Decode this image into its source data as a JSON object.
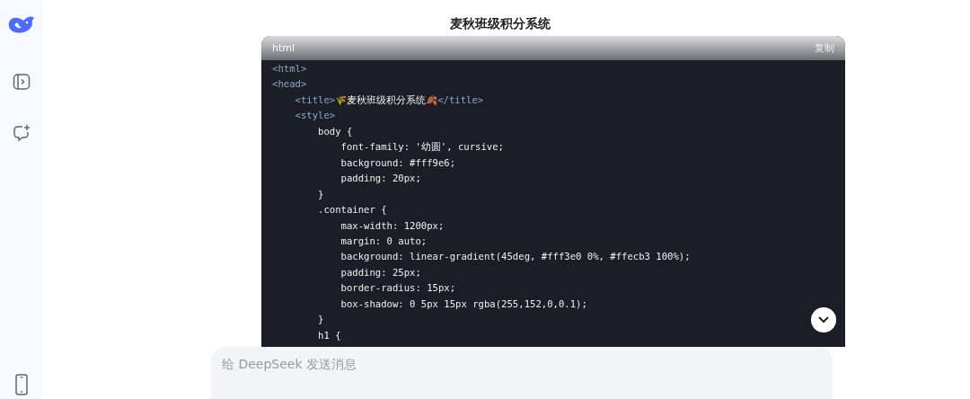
{
  "page_title": "麦秋班级积分系统",
  "code_block": {
    "language": "html",
    "copy_label": "复制",
    "lines": [
      [
        {
          "kind": "tag",
          "text": "<html>"
        }
      ],
      [
        {
          "kind": "tag",
          "text": "<head>"
        }
      ],
      [
        {
          "kind": "tag",
          "text": "    <title>"
        },
        {
          "kind": "text",
          "text": "🌾麦秋班级积分系统🍂"
        },
        {
          "kind": "tag",
          "text": "</title>"
        }
      ],
      [
        {
          "kind": "tag",
          "text": "    <style>"
        }
      ],
      [
        {
          "kind": "text",
          "text": "        body {"
        }
      ],
      [
        {
          "kind": "text",
          "text": "            font-family: '幼圆', cursive;"
        }
      ],
      [
        {
          "kind": "text",
          "text": "            background: #fff9e6;"
        }
      ],
      [
        {
          "kind": "text",
          "text": "            padding: 20px;"
        }
      ],
      [
        {
          "kind": "text",
          "text": "        }"
        }
      ],
      [
        {
          "kind": "text",
          "text": "        .container {"
        }
      ],
      [
        {
          "kind": "text",
          "text": "            max-width: 1200px;"
        }
      ],
      [
        {
          "kind": "text",
          "text": "            margin: 0 auto;"
        }
      ],
      [
        {
          "kind": "text",
          "text": "            background: linear-gradient(45deg, #fff3e0 0%, #ffecb3 100%);"
        }
      ],
      [
        {
          "kind": "text",
          "text": "            padding: 25px;"
        }
      ],
      [
        {
          "kind": "text",
          "text": "            border-radius: 15px;"
        }
      ],
      [
        {
          "kind": "text",
          "text": "            box-shadow: 0 5px 15px rgba(255,152,0,0.1);"
        }
      ],
      [
        {
          "kind": "text",
          "text": "        }"
        }
      ],
      [
        {
          "kind": "text",
          "text": "        h1 {"
        }
      ]
    ]
  },
  "composer": {
    "placeholder": "给 DeepSeek 发送消息"
  }
}
